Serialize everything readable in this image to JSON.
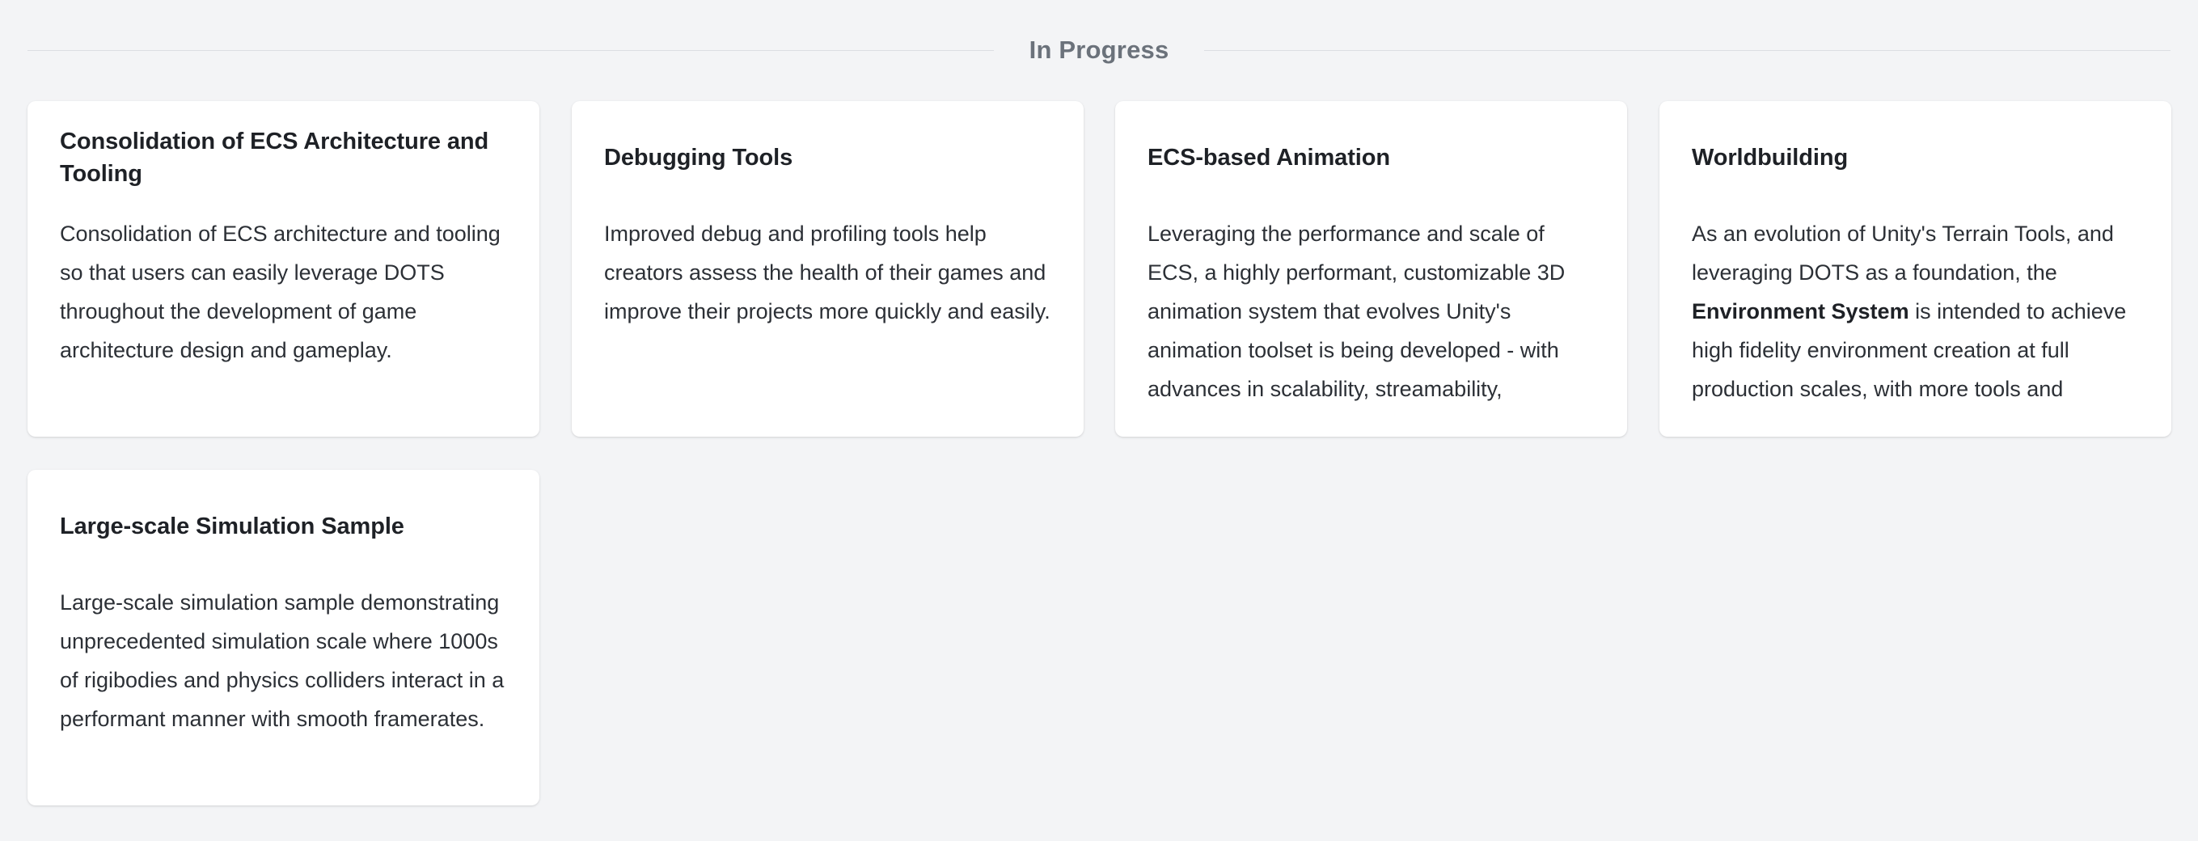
{
  "section": {
    "title": "In Progress"
  },
  "cards": [
    {
      "title": "Consolidation of ECS Architecture and Tooling",
      "body": "Consolidation of ECS architecture and tooling so that users can easily leverage DOTS throughout the development of game architecture design and gameplay."
    },
    {
      "title": "Debugging Tools",
      "body": "Improved debug and profiling tools help creators assess the health of their games and improve their projects more quickly and easily."
    },
    {
      "title": "ECS-based Animation",
      "body": "Leveraging the performance and scale of ECS, a highly performant, customizable 3D animation system that evolves Unity's animation toolset is being developed - with advances in scalability, streamability,"
    },
    {
      "title": "Worldbuilding",
      "body_before": "As an evolution of Unity's Terrain Tools, and leveraging DOTS as a foundation, the ",
      "body_bold": "Environment System",
      "body_after": " is intended to achieve high fidelity environment creation at full production scales, with more tools and"
    },
    {
      "title": "Large-scale Simulation Sample",
      "body": "Large-scale simulation sample demonstrating unprecedented simulation scale where 1000s of rigibodies and physics colliders interact in a performant manner with smooth framerates."
    }
  ]
}
